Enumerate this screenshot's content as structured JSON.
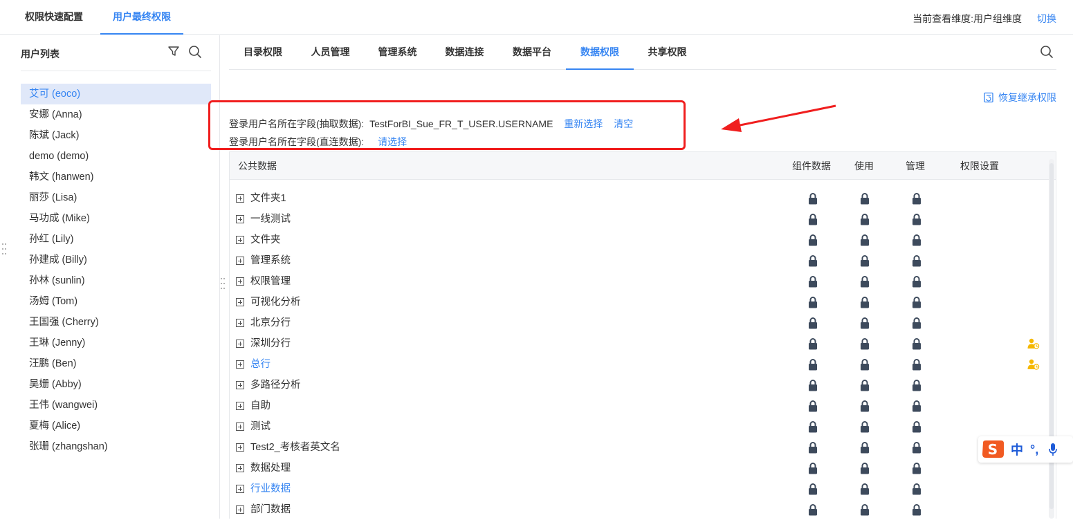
{
  "top_tabs": [
    {
      "label": "权限快速配置"
    },
    {
      "label": "用户最终权限"
    }
  ],
  "dimension": {
    "label": "当前查看维度:用户组维度",
    "switch_label": "切换"
  },
  "user_list": {
    "title": "用户列表",
    "users": [
      "艾可 (eoco)",
      "安娜 (Anna)",
      "陈斌 (Jack)",
      "demo (demo)",
      "韩文 (hanwen)",
      "丽莎 (Lisa)",
      "马功成 (Mike)",
      "孙红 (Lily)",
      "孙建成 (Billy)",
      "孙林 (sunlin)",
      "汤姆 (Tom)",
      "王国强 (Cherry)",
      "王琳 (Jenny)",
      "汪鹏 (Ben)",
      "吴姗 (Abby)",
      "王伟 (wangwei)",
      "夏梅 (Alice)",
      "张珊 (zhangshan)"
    ]
  },
  "sub_tabs": [
    {
      "label": "目录权限"
    },
    {
      "label": "人员管理"
    },
    {
      "label": "管理系统"
    },
    {
      "label": "数据连接"
    },
    {
      "label": "数据平台"
    },
    {
      "label": "数据权限"
    },
    {
      "label": "共享权限"
    }
  ],
  "restore_label": "恢复继承权限",
  "fields": {
    "extract_label": "登录用户名所在字段(抽取数据):",
    "extract_value": "TestForBI_Sue_FR_T_USER.USERNAME",
    "reselect": "重新选择",
    "clear": "清空",
    "direct_label": "登录用户名所在字段(直连数据):",
    "direct_select": "请选择"
  },
  "table": {
    "headers": {
      "name": "公共数据",
      "component": "组件数据",
      "use": "使用",
      "manage": "管理",
      "settings": "权限设置"
    },
    "rows": [
      {
        "name": "文件夹1",
        "link": false,
        "custom": false
      },
      {
        "name": "一线测试",
        "link": false,
        "custom": false
      },
      {
        "name": "文件夹",
        "link": false,
        "custom": false
      },
      {
        "name": "管理系统",
        "link": false,
        "custom": false
      },
      {
        "name": "权限管理",
        "link": false,
        "custom": false
      },
      {
        "name": "可视化分析",
        "link": false,
        "custom": false
      },
      {
        "name": "北京分行",
        "link": false,
        "custom": false
      },
      {
        "name": "深圳分行",
        "link": false,
        "custom": true
      },
      {
        "name": "总行",
        "link": true,
        "custom": true
      },
      {
        "name": "多路径分析",
        "link": false,
        "custom": false
      },
      {
        "name": "自助",
        "link": false,
        "custom": false
      },
      {
        "name": "测试",
        "link": false,
        "custom": false
      },
      {
        "name": "Test2_考核者英文名",
        "link": false,
        "custom": false
      },
      {
        "name": "数据处理",
        "link": false,
        "custom": false
      },
      {
        "name": "行业数据",
        "link": true,
        "custom": false
      },
      {
        "name": "部门数据",
        "link": false,
        "custom": false
      }
    ]
  },
  "ime": {
    "mode": "中",
    "punct": "°,"
  },
  "colors": {
    "accent": "#3685f2",
    "highlight": "#f01e1e",
    "lock": "#3d4a5c",
    "perm": "#f5b800"
  }
}
